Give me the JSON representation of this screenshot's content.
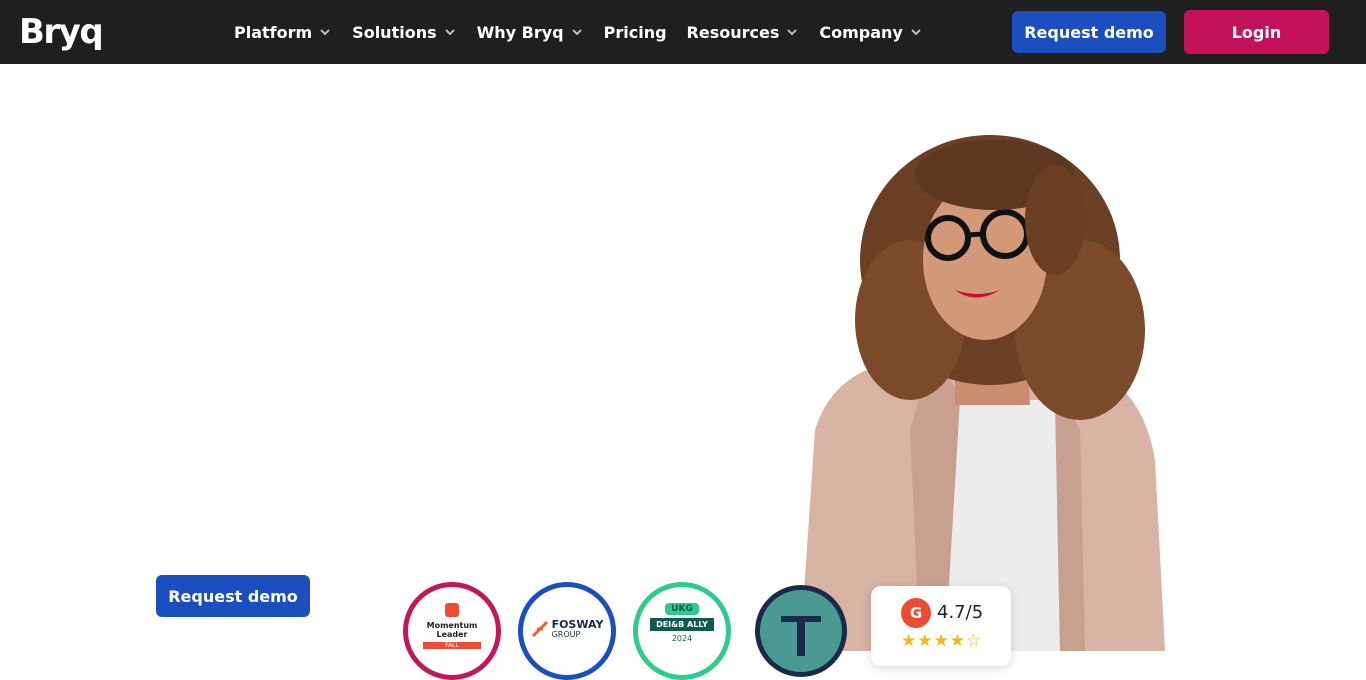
{
  "nav": {
    "logo": "Bryq",
    "items": [
      {
        "label": "Platform",
        "has_dropdown": true
      },
      {
        "label": "Solutions",
        "has_dropdown": true
      },
      {
        "label": "Why Bryq",
        "has_dropdown": true
      },
      {
        "label": "Pricing",
        "has_dropdown": false
      },
      {
        "label": "Resources",
        "has_dropdown": true
      },
      {
        "label": "Company",
        "has_dropdown": true
      }
    ],
    "request_demo": "Request demo",
    "login": "Login"
  },
  "hero": {
    "request_demo": "Request demo"
  },
  "badges": {
    "g2": {
      "line1": "Momentum",
      "line2": "Leader",
      "season": "FALL"
    },
    "fosway": {
      "name": "FOSWAY",
      "sub": "GROUP"
    },
    "ukg": {
      "top": "UKG",
      "ribbon": "DEI&B ALLY",
      "year": "2024"
    }
  },
  "rating": {
    "score": "4.7/5",
    "stars": "★★★★☆"
  },
  "colors": {
    "nav_bg": "#1f1f1f",
    "primary_blue": "#1b4fc0",
    "login_pink": "#c4125a"
  }
}
